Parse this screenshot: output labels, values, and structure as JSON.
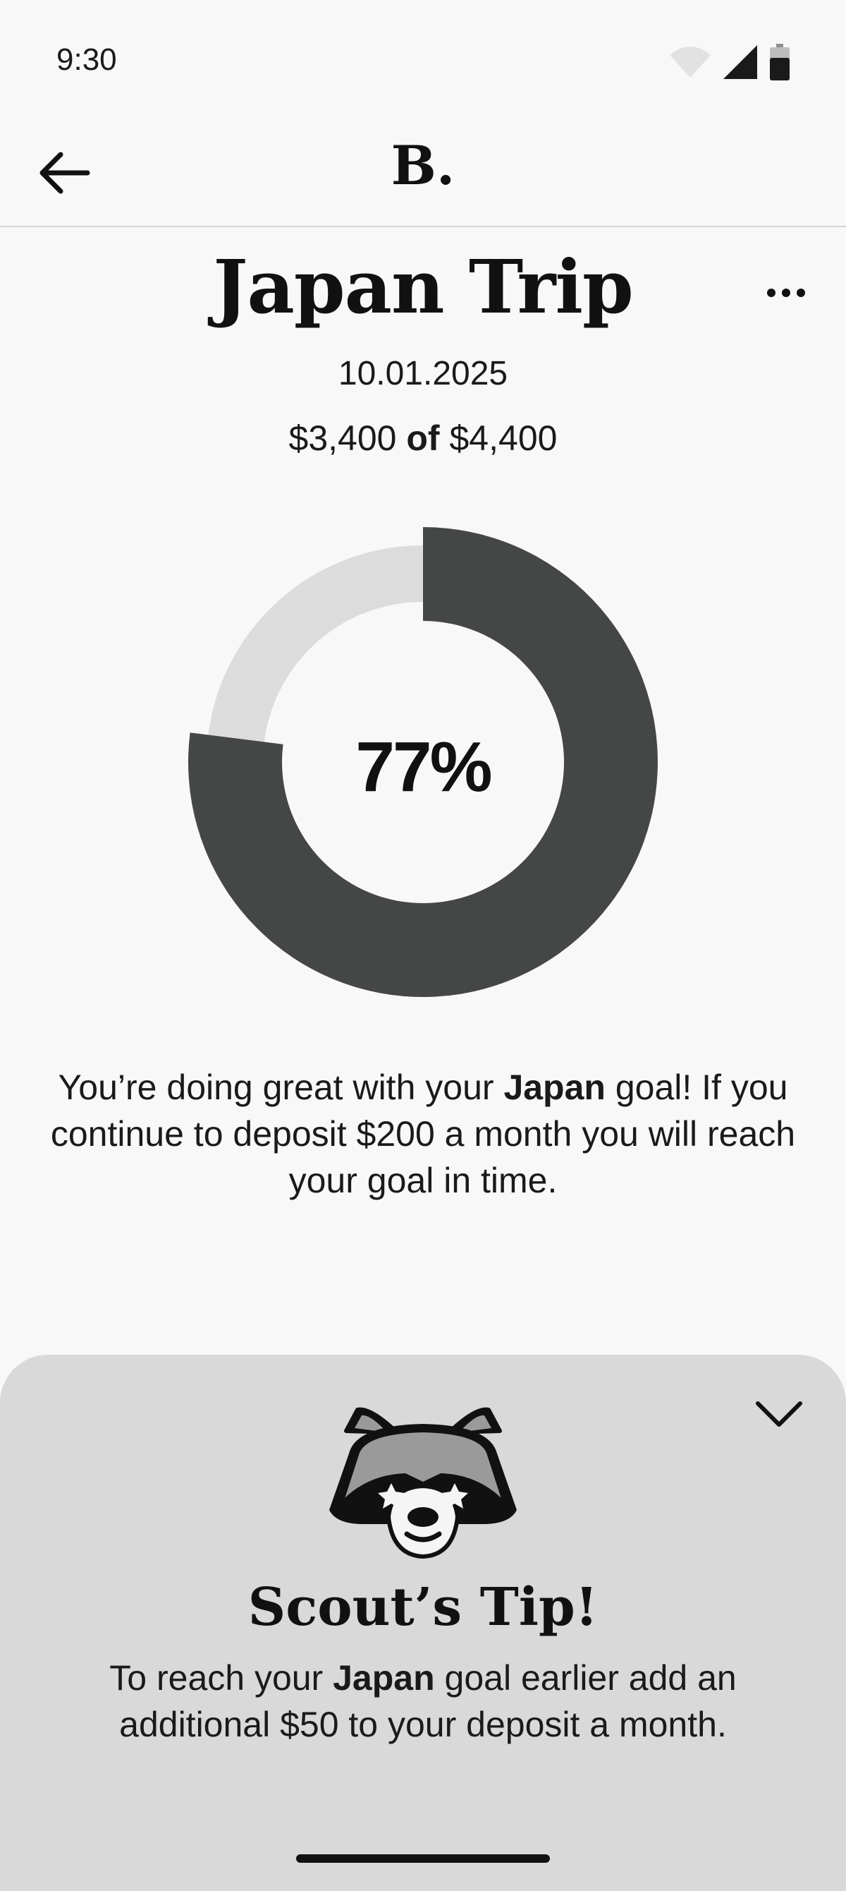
{
  "status_bar": {
    "time": "9:30",
    "icons": [
      "wifi-icon",
      "cellular-signal-icon",
      "battery-icon"
    ]
  },
  "app_bar": {
    "logo": "B.",
    "back_icon": "arrow-left-icon"
  },
  "goal": {
    "title": "Japan Trip",
    "date": "10.01.2025",
    "saved": "$3,400",
    "amount_connector": "of",
    "target": "$4,400",
    "progress_label": "77%",
    "progress_fraction": 0.77,
    "menu_icon": "more-horizontal-icon"
  },
  "message": {
    "prefix": "You’re doing great with your ",
    "goal_name": "Japan",
    "suffix": " goal! If you continue to deposit $200 a month you will reach your goal in time."
  },
  "tip": {
    "title": "Scout’s Tip!",
    "prefix": "To reach your ",
    "goal_name": "Japan",
    "suffix": " goal earlier add an additional $50 to your deposit a month.",
    "collapse_icon": "chevron-down-icon",
    "mascot_icon": "raccoon-mascot-icon"
  },
  "colors": {
    "background": "#f8f8f8",
    "progress": "#454746",
    "track": "#dcdcdc",
    "sheet": "#d9d9d9",
    "text": "#111111"
  }
}
